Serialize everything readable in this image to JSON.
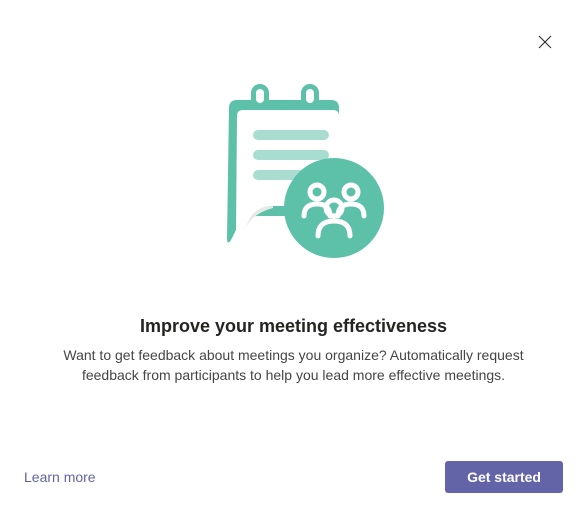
{
  "heading": "Improve your meeting effectiveness",
  "description": "Want to get feedback about meetings you organize? Automatically request feedback from participants to help you lead more effective meetings.",
  "footer": {
    "learn_more_label": "Learn more",
    "primary_label": "Get started"
  },
  "colors": {
    "accent": "#6264A7",
    "teal": "#5CC1A8",
    "teal_light": "#A8DDD0"
  }
}
